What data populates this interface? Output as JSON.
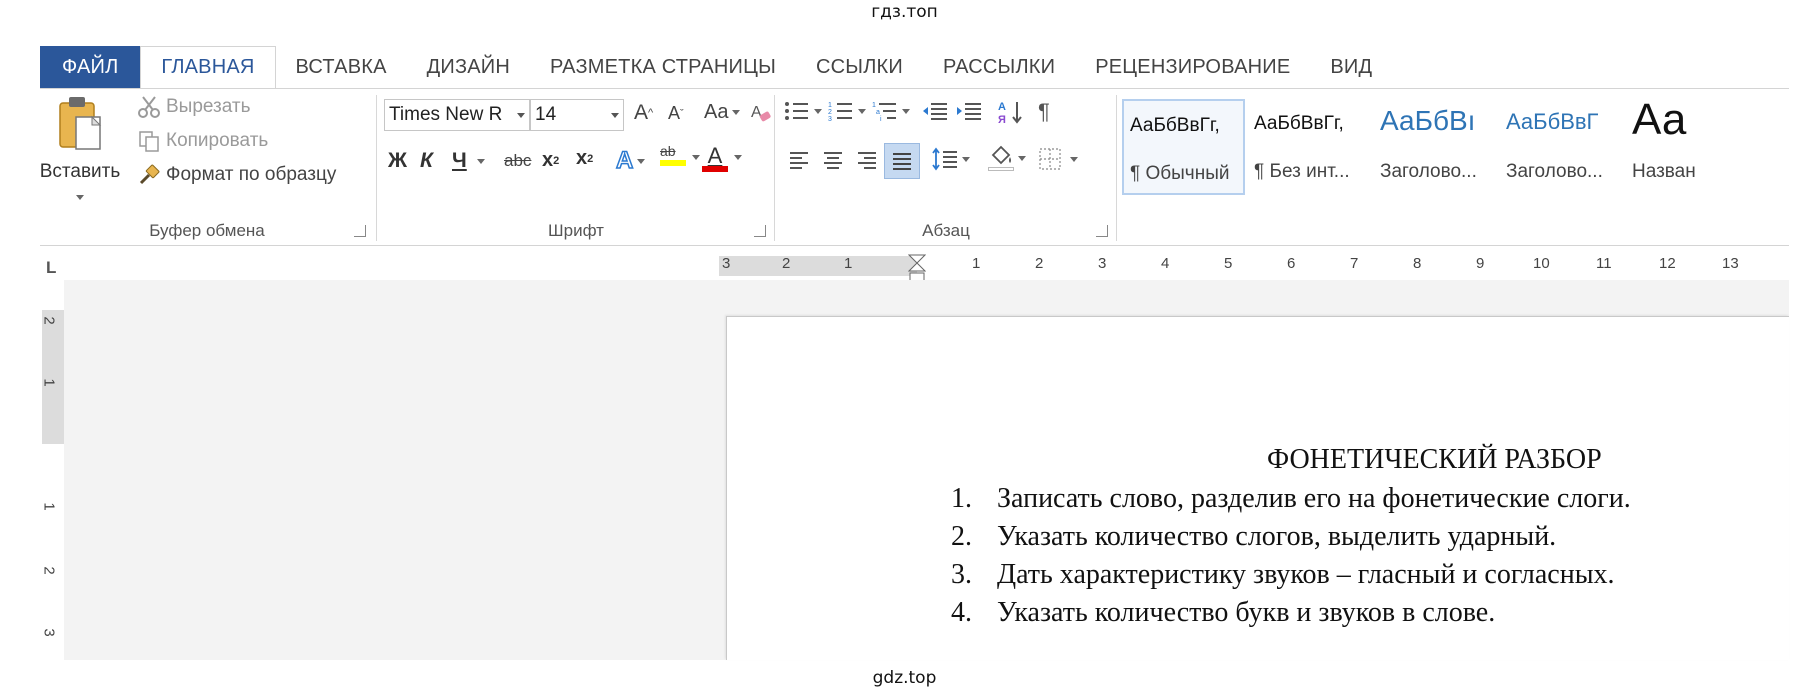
{
  "watermark": {
    "top": "гдз.топ",
    "bottom": "gdz.top"
  },
  "tabs": [
    {
      "label": "ФАЙЛ"
    },
    {
      "label": "ГЛАВНАЯ"
    },
    {
      "label": "ВСТАВКА"
    },
    {
      "label": "ДИЗАЙН"
    },
    {
      "label": "РАЗМЕТКА СТРАНИЦЫ"
    },
    {
      "label": "ССЫЛКИ"
    },
    {
      "label": "РАССЫЛКИ"
    },
    {
      "label": "РЕЦЕНЗИРОВАНИЕ"
    },
    {
      "label": "ВИД"
    }
  ],
  "clipboard": {
    "paste_label": "Вставить",
    "cut_label": "Вырезать",
    "copy_label": "Копировать",
    "format_painter_label": "Формат по образцу",
    "group_label": "Буфер обмена"
  },
  "font": {
    "font_name": "Times New R",
    "font_size": "14",
    "change_case_label": "Aa",
    "bold": "Ж",
    "italic": "К",
    "underline": "Ч",
    "strikethrough": "abc",
    "subscript": "x",
    "superscript": "x",
    "highlight_label": "ab",
    "font_color_label": "A",
    "text_effects_label": "A",
    "grow_label": "A",
    "shrink_label": "A",
    "group_label": "Шрифт",
    "highlight_color": "#ffff00",
    "font_color": "#e00000"
  },
  "paragraph": {
    "group_label": "Абзац",
    "show_marks": "¶"
  },
  "styles": [
    {
      "sample": "АаБбВвГг,",
      "name": "¶ Обычный"
    },
    {
      "sample": "АаБбВвГг,",
      "name": "¶ Без инт..."
    },
    {
      "sample": "АаБбВı",
      "name": "Заголово..."
    },
    {
      "sample": "АаБбВвГ",
      "name": "Заголово..."
    },
    {
      "sample": "Аа",
      "name": "Назван"
    }
  ],
  "ruler": {
    "corner": "L",
    "left_ticks": [
      "3",
      "2",
      "1"
    ],
    "right_ticks": [
      "1",
      "2",
      "3",
      "4",
      "5",
      "6",
      "7",
      "8",
      "9",
      "10",
      "11",
      "12",
      "13"
    ],
    "vertical_ticks": [
      "2",
      "1",
      "1",
      "2",
      "3"
    ]
  },
  "document": {
    "title": "ФОНЕТИЧЕСКИЙ РАЗБОР",
    "items": [
      {
        "num": "1.",
        "text": "Записать слово, разделив его на фонетические слоги."
      },
      {
        "num": "2.",
        "text": "Указать количество слогов, выделить ударный."
      },
      {
        "num": "3.",
        "text": "Дать характеристику звуков – гласный и согласных."
      },
      {
        "num": "4.",
        "text": "Указать количество букв и звуков в слове."
      }
    ]
  }
}
